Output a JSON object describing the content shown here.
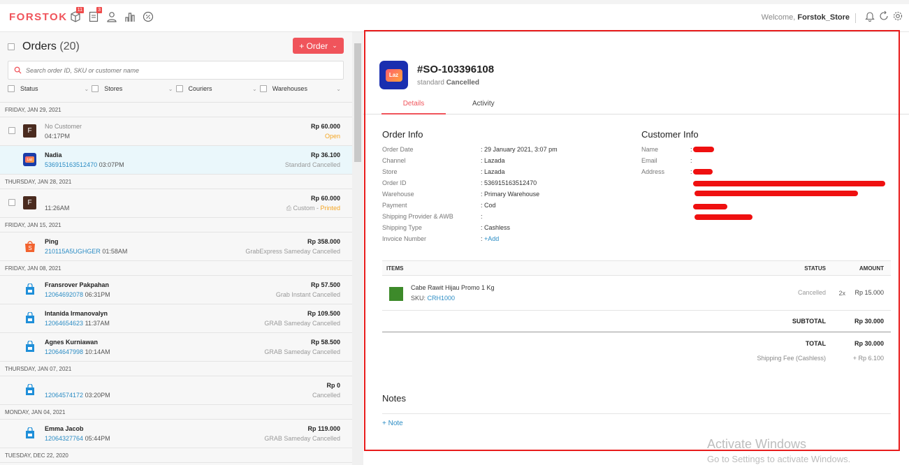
{
  "topbar": {
    "logo": "FORSTOK",
    "badges": {
      "box": "11",
      "doc": "3"
    },
    "welcome_prefix": "Welcome,",
    "username": "Forstok_Store"
  },
  "orders": {
    "title": "Orders",
    "count": "(20)",
    "add_button": "+ Order",
    "search_placeholder": "Search order ID, SKU or customer name",
    "filters": [
      "Status",
      "Stores",
      "Couriers",
      "Warehouses"
    ],
    "groups": [
      {
        "date": "FRIDAY, JAN 29, 2021",
        "rows": [
          {
            "avatar": "F",
            "kind": "f",
            "name": "No Customer",
            "id": "",
            "time": "04:17PM",
            "amount": "Rp 60.000",
            "courier": "",
            "status": "Open",
            "status_color": "orange",
            "checkbox": true
          },
          {
            "avatar": "Laz",
            "kind": "lazada",
            "name": "Nadia",
            "id": "536915163512470",
            "time": "03:07PM",
            "amount": "Rp 36.100",
            "courier": "Standard",
            "status": "Cancelled",
            "selected": true,
            "checkbox": false
          }
        ]
      },
      {
        "date": "THURSDAY, JAN 28, 2021",
        "rows": [
          {
            "avatar": "F",
            "kind": "f",
            "name": "",
            "id": "",
            "time": "11:26AM",
            "amount": "Rp 60.000",
            "courier": "Custom",
            "status": "Printed",
            "status_color": "orange",
            "checkbox": true,
            "printer": true
          }
        ]
      },
      {
        "date": "FRIDAY, JAN 15, 2021",
        "rows": [
          {
            "avatar": "S",
            "kind": "shopee",
            "name": "Ping",
            "id": "210115A5UGHGER",
            "time": "01:58AM",
            "amount": "Rp 358.000",
            "courier": "GrabExpress Sameday",
            "status": "Cancelled",
            "checkbox": false
          }
        ]
      },
      {
        "date": "FRIDAY, JAN 08, 2021",
        "rows": [
          {
            "avatar": "B",
            "kind": "bag",
            "name": "Fransrover Pakpahan",
            "id": "12064692078",
            "time": "06:31PM",
            "amount": "Rp 57.500",
            "courier": "Grab Instant",
            "status": "Cancelled",
            "checkbox": false
          },
          {
            "avatar": "B",
            "kind": "bag",
            "name": "Intanida Irmanovalyn",
            "id": "12064654623",
            "time": "11:37AM",
            "amount": "Rp 109.500",
            "courier": "GRAB Sameday",
            "status": "Cancelled",
            "checkbox": false
          },
          {
            "avatar": "B",
            "kind": "bag",
            "name": "Agnes Kurniawan",
            "id": "12064647998",
            "time": "10:14AM",
            "amount": "Rp 58.500",
            "courier": "GRAB Sameday",
            "status": "Cancelled",
            "checkbox": false
          }
        ]
      },
      {
        "date": "THURSDAY, JAN 07, 2021",
        "rows": [
          {
            "avatar": "B",
            "kind": "bag",
            "name": "",
            "id": "12064574172",
            "time": "03:20PM",
            "amount": "Rp 0",
            "courier": "",
            "status": "Cancelled",
            "checkbox": false
          }
        ]
      },
      {
        "date": "MONDAY, JAN 04, 2021",
        "rows": [
          {
            "avatar": "B",
            "kind": "bag",
            "name": "Emma Jacob",
            "id": "12064327764",
            "time": "05:44PM",
            "amount": "Rp 119.000",
            "courier": "GRAB Sameday",
            "status": "Cancelled",
            "checkbox": false
          }
        ]
      },
      {
        "date": "TUESDAY, DEC 22, 2020",
        "rows": []
      }
    ]
  },
  "detail": {
    "logo_text": "Laz",
    "order_no": "#SO-103396108",
    "subtitle_prefix": "standard",
    "subtitle_status": "Cancelled",
    "tabs": [
      "Details",
      "Activity"
    ],
    "order_info_title": "Order Info",
    "order_info": [
      {
        "label": "Order Date",
        "value": ": 29 January 2021, 3:07 pm"
      },
      {
        "label": "Channel",
        "value": ": Lazada"
      },
      {
        "label": "Store",
        "value": ": Lazada"
      },
      {
        "label": "Order ID",
        "value": ": 536915163512470"
      },
      {
        "label": "Warehouse",
        "value": ": Primary Warehouse"
      },
      {
        "label": "Payment",
        "value": ": Cod"
      },
      {
        "label": "Shipping Provider & AWB",
        "value": ":"
      },
      {
        "label": "Shipping Type",
        "value": ": Cashless"
      },
      {
        "label": "Invoice Number",
        "value": ":",
        "link": "+Add"
      }
    ],
    "customer_info_title": "Customer Info",
    "customer_info": [
      {
        "label": "Name",
        "value": ":"
      },
      {
        "label": "Email",
        "value": ":"
      },
      {
        "label": "Address",
        "value": ":"
      }
    ],
    "items_header": {
      "items": "ITEMS",
      "status": "STATUS",
      "amount": "AMOUNT"
    },
    "items": [
      {
        "name": "Cabe Rawit Hijau Promo 1 Kg",
        "sku_label": "SKU:",
        "sku": "CRH1000",
        "status": "Cancelled",
        "qty": "2x",
        "price": "Rp 15.000"
      }
    ],
    "subtotal_label": "SUBTOTAL",
    "subtotal": "Rp 30.000",
    "total_label": "TOTAL",
    "total": "Rp 30.000",
    "shipping_label": "Shipping Fee (Cashless)",
    "shipping": "+ Rp 6.100",
    "notes_title": "Notes",
    "add_note": "+ Note"
  },
  "watermark": {
    "line1": "Activate Windows",
    "line2": "Go to Settings to activate Windows."
  },
  "colors": {
    "accent": "#f0545b",
    "link": "#2b8cc4",
    "highlight": "#e81c1c"
  }
}
